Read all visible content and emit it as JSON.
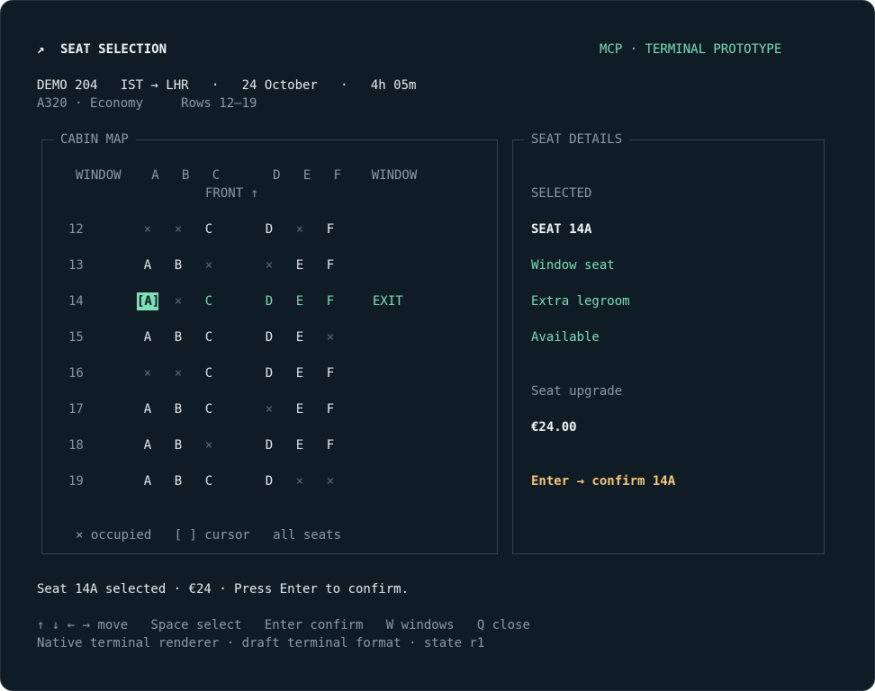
{
  "header": {
    "icon": "arrow-up-right-icon",
    "title": "SEAT SELECTION",
    "tag": "MCP · TERMINAL PROTOTYPE"
  },
  "flight": {
    "line1": "DEMO 204   IST → LHR   ·   24 October   ·   4h 05m",
    "line2": "A320 · Economy     Rows 12–19"
  },
  "cabin": {
    "title": "CABIN MAP",
    "header_row": "WINDOW    A   B   C       D   E   F    WINDOW",
    "front_label": "FRONT ↑",
    "rows": [
      {
        "num": "12",
        "seats": [
          "×",
          "×",
          "C",
          "D",
          "×",
          "F"
        ],
        "note": ""
      },
      {
        "num": "13",
        "seats": [
          "A",
          "B",
          "×",
          "×",
          "E",
          "F"
        ],
        "note": ""
      },
      {
        "num": "14",
        "seats": [
          "[A]",
          "×",
          "C",
          "D",
          "E",
          "F"
        ],
        "note": "EXIT"
      },
      {
        "num": "15",
        "seats": [
          "A",
          "B",
          "C",
          "D",
          "E",
          "×"
        ],
        "note": ""
      },
      {
        "num": "16",
        "seats": [
          "×",
          "×",
          "C",
          "D",
          "E",
          "F"
        ],
        "note": ""
      },
      {
        "num": "17",
        "seats": [
          "A",
          "B",
          "C",
          "×",
          "E",
          "F"
        ],
        "note": ""
      },
      {
        "num": "18",
        "seats": [
          "A",
          "B",
          "×",
          "D",
          "E",
          "F"
        ],
        "note": ""
      },
      {
        "num": "19",
        "seats": [
          "A",
          "B",
          "C",
          "D",
          "×",
          "×"
        ],
        "note": ""
      }
    ],
    "legend": "× occupied   [ ] cursor   all seats"
  },
  "details": {
    "title": "SEAT DETAILS",
    "selected_label": "SELECTED",
    "seat": "SEAT 14A",
    "attr1": "Window seat",
    "attr2": "Extra legroom",
    "attr3": "Available",
    "upgrade_label": "Seat upgrade",
    "price": "€24.00",
    "confirm": "Enter → confirm 14A"
  },
  "status": "Seat 14A selected · €24 · Press Enter to confirm.",
  "keys": "↑ ↓ ← → move   Space select   Enter confirm   W windows   Q close",
  "footer": "Native terminal renderer · draft terminal format · state r1",
  "colors": {
    "background": "#0f1c26",
    "accent": "#7ee0b4",
    "highlight": "#f5c877",
    "muted": "#8e9aa5"
  }
}
